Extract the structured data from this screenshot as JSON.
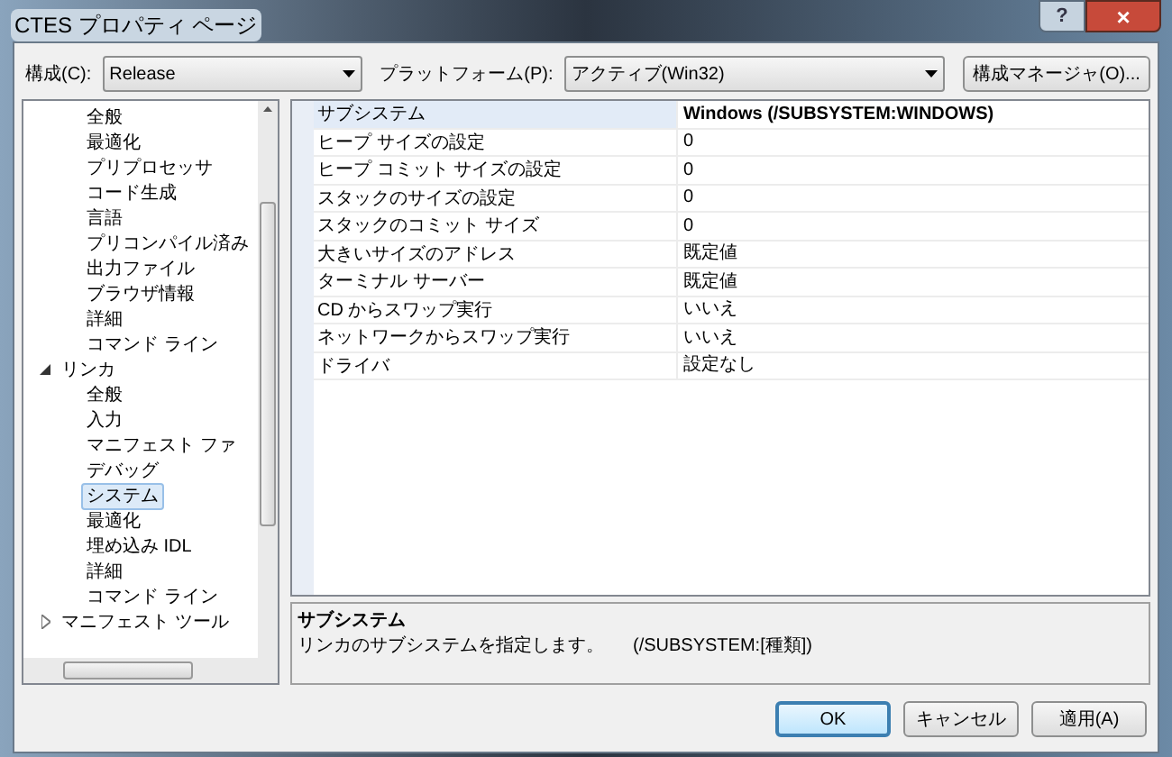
{
  "window": {
    "title": "CTES プロパティ ページ",
    "help_button": "?",
    "close_button": "×"
  },
  "toolbar": {
    "configuration_label": "構成(C):",
    "configuration_value": "Release",
    "platform_label": "プラットフォーム(P):",
    "platform_value": "アクティブ(Win32)",
    "manager_button": "構成マネージャ(O)..."
  },
  "tree": [
    {
      "children": [
        {
          "label": "全般",
          "selected": false
        },
        {
          "label": "最適化",
          "selected": false
        },
        {
          "label": "プリプロセッサ",
          "selected": false
        },
        {
          "label": "コード生成",
          "selected": false
        },
        {
          "label": "言語",
          "selected": false
        },
        {
          "label": "プリコンパイル済み",
          "selected": false
        },
        {
          "label": "出力ファイル",
          "selected": false
        },
        {
          "label": "ブラウザ情報",
          "selected": false
        },
        {
          "label": "詳細",
          "selected": false
        },
        {
          "label": "コマンド ライン",
          "selected": false
        }
      ]
    },
    {
      "label": "リンカ",
      "expanded": true,
      "selected": false,
      "children": [
        {
          "label": "全般",
          "selected": false
        },
        {
          "label": "入力",
          "selected": false
        },
        {
          "label": "マニフェスト ファ",
          "selected": false
        },
        {
          "label": "デバッグ",
          "selected": false
        },
        {
          "label": "システム",
          "selected": true
        },
        {
          "label": "最適化",
          "selected": false
        },
        {
          "label": "埋め込み IDL",
          "selected": false
        },
        {
          "label": "詳細",
          "selected": false
        },
        {
          "label": "コマンド ライン",
          "selected": false
        }
      ]
    },
    {
      "label": "マニフェスト ツール",
      "expanded": false,
      "selected": false
    }
  ],
  "properties": [
    {
      "name": "サブシステム",
      "value": "Windows (/SUBSYSTEM:WINDOWS)",
      "selected": true,
      "modified": true
    },
    {
      "name": "ヒープ サイズの設定",
      "value": "0",
      "selected": false,
      "modified": false
    },
    {
      "name": "ヒープ コミット サイズの設定",
      "value": "0",
      "selected": false,
      "modified": false
    },
    {
      "name": "スタックのサイズの設定",
      "value": "0",
      "selected": false,
      "modified": false
    },
    {
      "name": "スタックのコミット サイズ",
      "value": "0",
      "selected": false,
      "modified": false
    },
    {
      "name": "大きいサイズのアドレス",
      "value": "既定値",
      "selected": false,
      "modified": false
    },
    {
      "name": "ターミナル サーバー",
      "value": "既定値",
      "selected": false,
      "modified": false
    },
    {
      "name": "CD からスワップ実行",
      "value": "いいえ",
      "selected": false,
      "modified": false
    },
    {
      "name": "ネットワークからスワップ実行",
      "value": "いいえ",
      "selected": false,
      "modified": false
    },
    {
      "name": "ドライバ",
      "value": "設定なし",
      "selected": false,
      "modified": false
    }
  ],
  "description": {
    "title": "サブシステム",
    "text": "リンカのサブシステムを指定します。",
    "option": "(/SUBSYSTEM:[種類])"
  },
  "buttons": [
    {
      "label": "OK",
      "default": true
    },
    {
      "label": "キャンセル",
      "default": false
    },
    {
      "label": "適用(A)",
      "default": false
    }
  ]
}
